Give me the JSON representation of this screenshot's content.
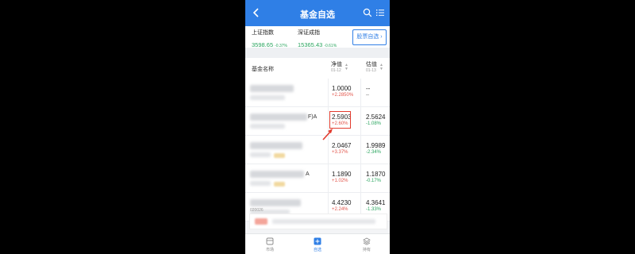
{
  "header": {
    "title": "基金自选",
    "back_icon": "chevron-left-icon",
    "search_icon": "search-icon",
    "menu_icon": "list-menu-icon"
  },
  "indices": [
    {
      "name": "上证指数",
      "value": "3598.65",
      "change": "-0.37%"
    },
    {
      "name": "深证成指",
      "value": "15365.43",
      "change": "-0.61%"
    }
  ],
  "index_button": "股票自选",
  "table": {
    "name_header": "基金名称",
    "columns": [
      {
        "label": "净值",
        "date": "01-12"
      },
      {
        "label": "估值",
        "date": "01-13"
      }
    ],
    "rows": [
      {
        "name_tail": "",
        "nav": "1.0000",
        "nav_change": "+2.2850%",
        "est": "--",
        "est_change": "--"
      },
      {
        "name_tail": "F)A",
        "nav": "2.5903",
        "nav_change": "+2.60%",
        "est": "2.5624",
        "est_change": "-1.08%"
      },
      {
        "name_tail": "",
        "nav": "2.0467",
        "nav_change": "+3.37%",
        "est": "1.9989",
        "est_change": "-2.34%"
      },
      {
        "name_tail": "A",
        "nav": "1.1890",
        "nav_change": "+1.02%",
        "est": "1.1870",
        "est_change": "-0.17%"
      },
      {
        "name_tail": "",
        "nav": "4.4230",
        "nav_change": "+2.24%",
        "est": "4.3641",
        "est_change": "-1.33%"
      }
    ],
    "trailing_code": "020026"
  },
  "tabs": [
    {
      "label": "市场",
      "icon": "market-icon"
    },
    {
      "label": "自选",
      "icon": "watchlist-icon"
    },
    {
      "label": "持有",
      "icon": "holdings-icon"
    }
  ],
  "colors": {
    "nav_blue": "#2f7fe6",
    "up_red": "#e2554b",
    "down_green": "#2aa55f",
    "highlight_red": "#e23b2e"
  }
}
